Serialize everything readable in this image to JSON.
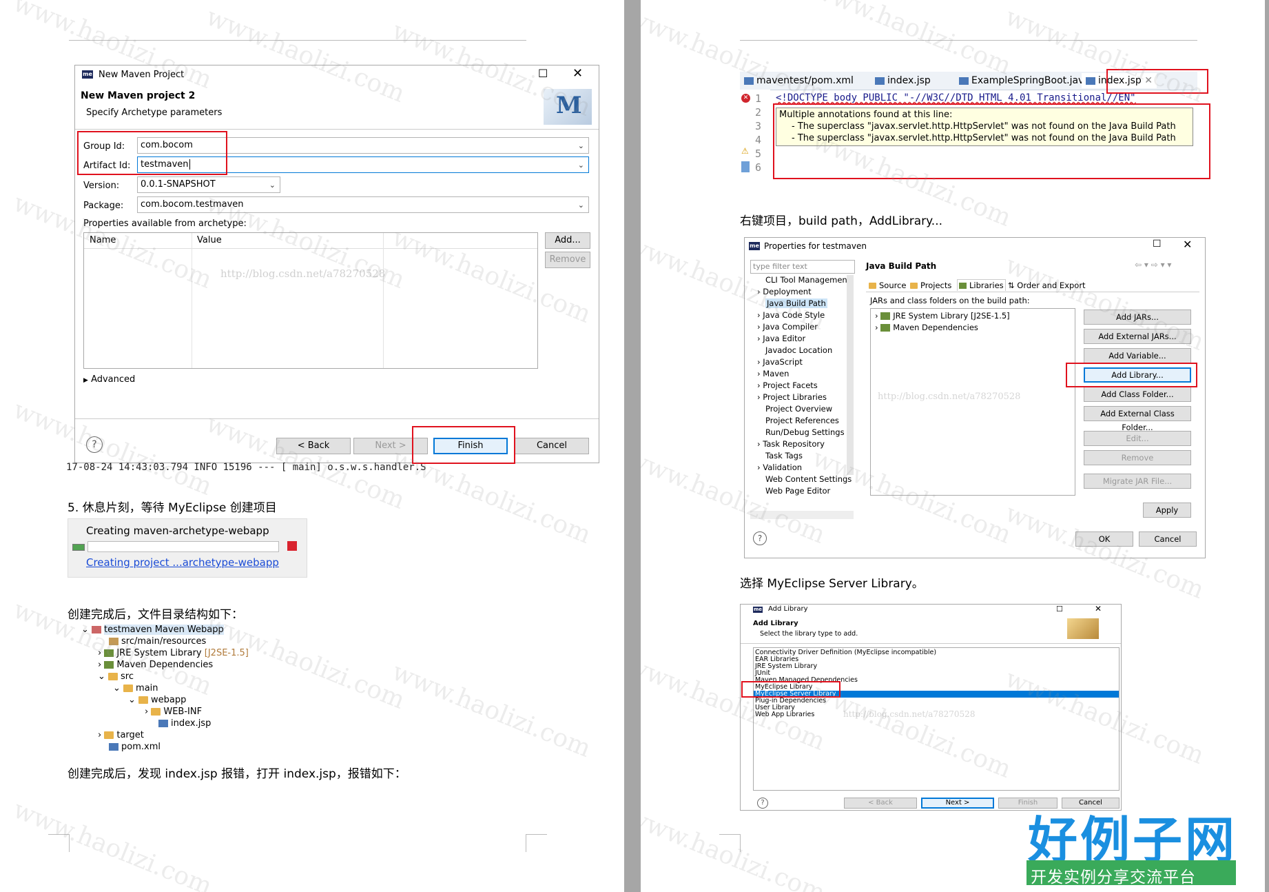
{
  "left_page": {
    "maven_dialog": {
      "title": "New Maven Project",
      "header": "New Maven project 2",
      "subheader": "Specify Archetype parameters",
      "logo_letter": "M",
      "group_id_label": "Group Id:",
      "group_id_value": "com.bocom",
      "artifact_id_label": "Artifact Id:",
      "artifact_id_value": "testmaven",
      "version_label": "Version:",
      "version_value": "0.0.1-SNAPSHOT",
      "package_label": "Package:",
      "package_value": "com.bocom.testmaven",
      "props_label": "Properties available from archetype:",
      "col_name": "Name",
      "col_value": "Value",
      "watermark": "http://blog.csdn.net/a78270528",
      "add_button": "Add...",
      "remove_button": "Remove",
      "advanced": "Advanced",
      "back_button": "< Back",
      "next_button": "Next >",
      "finish_button": "Finish",
      "cancel_button": "Cancel",
      "console_line": "17-08-24 14:43:03.794  INFO 15196 --- [           main] o.s.w.s.handler.S"
    },
    "step5_text": "5. 休息片刻，等待 MyEclipse 创建项目",
    "progress": {
      "title": "Creating maven-archetype-webapp",
      "link": "Creating project ...archetype-webapp"
    },
    "tree_intro": "创建完成后，文件目录结构如下：",
    "tree": {
      "root": "testmaven Maven Webapp",
      "resources": "src/main/resources",
      "jre": "JRE System Library",
      "jre_version": "[J2SE-1.5]",
      "maven_deps": "Maven Dependencies",
      "src": "src",
      "main": "main",
      "webapp": "webapp",
      "webinf": "WEB-INF",
      "indexjsp": "index.jsp",
      "target": "target",
      "pom": "pom.xml"
    },
    "error_intro": "创建完成后，发现 index.jsp 报错，打开 index.jsp，报错如下："
  },
  "right_page": {
    "editor": {
      "tabs": [
        "maventest/pom.xml",
        "index.jsp",
        "ExampleSpringBoot.java",
        "index.jsp"
      ],
      "line_numbers": [
        "1",
        "2",
        "3",
        "4",
        "5",
        "6"
      ],
      "code_line": "<!DOCTYPE body PUBLIC \"-//W3C//DTD HTML 4.01 Transitional//EN\"",
      "tooltip_title": "Multiple annotations found at this line:",
      "tooltip_line1": "- The superclass \"javax.servlet.http.HttpServlet\" was not found on the Java Build Path",
      "tooltip_line2": "- The superclass \"javax.servlet.http.HttpServlet\" was not found on the Java Build Path"
    },
    "text1": "右键项目，build path，AddLibrary...",
    "props_dialog": {
      "title": "Properties for testmaven",
      "filter_placeholder": "type filter text",
      "nav_items": [
        "CLI Tool Managemen",
        "Deployment",
        "Java Build Path",
        "Java Code Style",
        "Java Compiler",
        "Java Editor",
        "Javadoc Location",
        "JavaScript",
        "Maven",
        "Project Facets",
        "Project Libraries",
        "Project Overview",
        "Project References",
        "Run/Debug Settings",
        "Task Repository",
        "Task Tags",
        "Validation",
        "Web Content Settings",
        "Web Page Editor"
      ],
      "heading": "Java Build Path",
      "tabs": [
        "Source",
        "Projects",
        "Libraries",
        "Order and Export"
      ],
      "jars_label": "JARs and class folders on the build path:",
      "libs": [
        "JRE System Library [J2SE-1.5]",
        "Maven Dependencies"
      ],
      "buttons": [
        "Add JARs...",
        "Add External JARs...",
        "Add Variable...",
        "Add Library...",
        "Add Class Folder...",
        "Add External Class Folder...",
        "Edit...",
        "Remove",
        "Migrate JAR File..."
      ],
      "watermark": "http://blog.csdn.net/a78270528",
      "apply": "Apply",
      "ok": "OK",
      "cancel": "Cancel"
    },
    "text2": "选择 MyEclipse Server Library。",
    "addlib_dialog": {
      "title": "Add Library",
      "heading": "Add Library",
      "subheading": "Select the library type to add.",
      "items": [
        "Connectivity Driver Definition (MyEclipse incompatible)",
        "EAR Libraries",
        "JRE System Library",
        "JUnit",
        "Maven Managed Dependencies",
        "MyEclipse Library",
        "MyEclipse Server Library",
        "Plug-in Dependencies",
        "User Library",
        "Web App Libraries"
      ],
      "watermark": "http://blog.csdn.net/a78270528",
      "back": "< Back",
      "next": "Next >",
      "finish": "Finish",
      "cancel": "Cancel"
    }
  },
  "brand": {
    "logo_text": "好例子网",
    "slogan": "开发实例分享交流平台"
  },
  "watermark_text": "www.haolizi.com",
  "colors": {
    "red_highlight": "#e0111d",
    "selection_blue": "#0078d7",
    "brand_blue": "#1a8fe0",
    "brand_green": "#3aaa5a"
  }
}
